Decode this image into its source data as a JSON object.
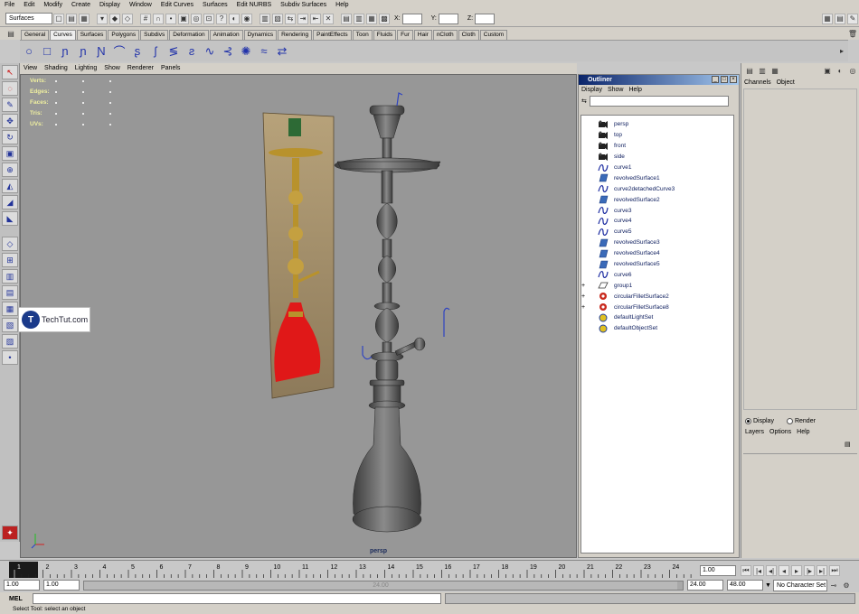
{
  "menubar": [
    "File",
    "Edit",
    "Modify",
    "Create",
    "Display",
    "Window",
    "Edit Curves",
    "Surfaces",
    "Edit NURBS",
    "Subdiv Surfaces",
    "Help"
  ],
  "status": {
    "menu_set": "Surfaces",
    "x_label": "X:",
    "y_label": "Y:",
    "z_label": "Z:"
  },
  "shelf_tabs": [
    "General",
    "Curves",
    "Surfaces",
    "Polygons",
    "Subdivs",
    "Deformation",
    "Animation",
    "Dynamics",
    "Rendering",
    "PaintEffects",
    "Toon",
    "Fluids",
    "Fur",
    "Hair",
    "nCloth",
    "Cloth",
    "Custom"
  ],
  "active_shelf_tab": "Curves",
  "viewport": {
    "menu": [
      "View",
      "Shading",
      "Lighting",
      "Show",
      "Renderer",
      "Panels"
    ],
    "hud": [
      {
        "label": "Verts:"
      },
      {
        "label": "Edges:"
      },
      {
        "label": "Faces:"
      },
      {
        "label": "Tris:"
      },
      {
        "label": "UVs:"
      }
    ],
    "camera_label": "persp"
  },
  "watermark": {
    "text": "TechTut.com"
  },
  "outliner": {
    "title": "Outliner",
    "menu": [
      "Display",
      "Show",
      "Help"
    ],
    "items": [
      {
        "label": "persp",
        "icon": "camera-icon",
        "expand": ""
      },
      {
        "label": "top",
        "icon": "camera-icon",
        "expand": ""
      },
      {
        "label": "front",
        "icon": "camera-icon",
        "expand": ""
      },
      {
        "label": "side",
        "icon": "camera-icon",
        "expand": ""
      },
      {
        "label": "curve1",
        "icon": "curve-icon",
        "expand": ""
      },
      {
        "label": "revolvedSurface1",
        "icon": "surface-icon",
        "expand": ""
      },
      {
        "label": "curve2detachedCurve3",
        "icon": "curve-icon",
        "expand": ""
      },
      {
        "label": "revolvedSurface2",
        "icon": "surface-icon",
        "expand": ""
      },
      {
        "label": "curve3",
        "icon": "curve-icon",
        "expand": ""
      },
      {
        "label": "curve4",
        "icon": "curve-icon",
        "expand": ""
      },
      {
        "label": "curve5",
        "icon": "curve-icon",
        "expand": ""
      },
      {
        "label": "revolvedSurface3",
        "icon": "surface-icon",
        "expand": ""
      },
      {
        "label": "revolvedSurface4",
        "icon": "surface-icon",
        "expand": ""
      },
      {
        "label": "revolvedSurface5",
        "icon": "surface-icon",
        "expand": ""
      },
      {
        "label": "curve6",
        "icon": "curve-icon",
        "expand": ""
      },
      {
        "label": "group1",
        "icon": "group-icon",
        "expand": "+"
      },
      {
        "label": "circularFilletSurface2",
        "icon": "fillet-icon",
        "expand": "+"
      },
      {
        "label": "circularFilletSurface8",
        "icon": "fillet-icon",
        "expand": "+"
      },
      {
        "label": "defaultLightSet",
        "icon": "set-icon",
        "expand": ""
      },
      {
        "label": "defaultObjectSet",
        "icon": "set-icon",
        "expand": ""
      }
    ]
  },
  "channel_box": {
    "menu": [
      "Channels",
      "Object"
    ]
  },
  "layer_editor": {
    "display": "Display",
    "render": "Render",
    "menu": [
      "Layers",
      "Options",
      "Help"
    ]
  },
  "timeline": {
    "ticks": [
      "1",
      "2",
      "3",
      "4",
      "5",
      "6",
      "7",
      "8",
      "9",
      "10",
      "11",
      "12",
      "13",
      "14",
      "15",
      "16",
      "17",
      "18",
      "19",
      "20",
      "21",
      "22",
      "23",
      "24"
    ],
    "current": "1.00"
  },
  "range": {
    "start": "1.00",
    "start2": "1.00",
    "slider_label": "24.00",
    "end": "24.00",
    "end2": "48.00",
    "char_set": "No Character Set"
  },
  "command": {
    "label": "MEL"
  },
  "help_line": "Select Tool: select an object"
}
